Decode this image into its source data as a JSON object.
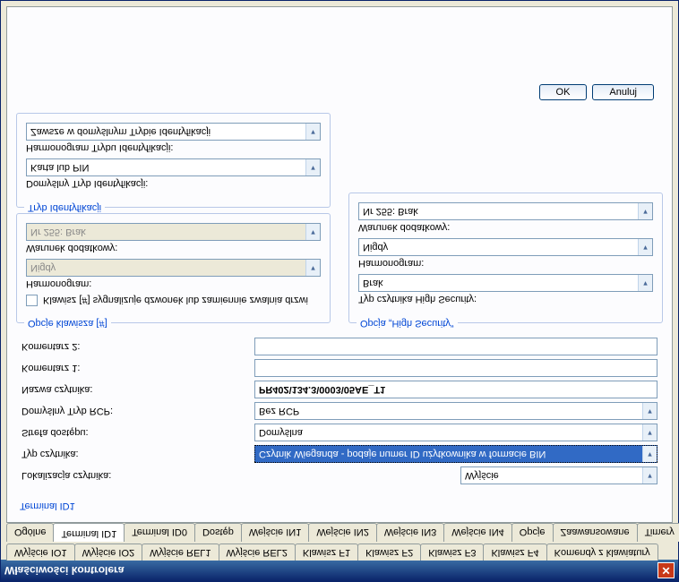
{
  "window_title": "Właściwości kontrolera",
  "buttons": {
    "ok": "OK",
    "cancel": "Anuluj"
  },
  "tabs_row1": [
    "Wyjście IO1",
    "Wyjście IO2",
    "Wyjście REL1",
    "Wyjście REL2",
    "Klawisz F1",
    "Klawisz F2",
    "Klawisz F3",
    "Klawisz F4",
    "Komendy z klawiatury"
  ],
  "tabs_row2": [
    "Ogólne",
    "Terminal ID1",
    "Terminal ID0",
    "Dostęp",
    "Wejście IN1",
    "Wejście IN2",
    "Wejście IN3",
    "Wejście IN4",
    "Opcje",
    "Zaawansowane",
    "Timery"
  ],
  "active_tab": "Terminal ID1",
  "terminal": {
    "section_title": "Terminal ID1",
    "lokalizacja_label": "Lokalizacja czytnika:",
    "lokalizacja_value": "Wyjście",
    "typ_label": "Typ czytnika:",
    "typ_value": "Czytnik Wieganda - podaje numer ID użytkownika w formacie BIN",
    "strefa_label": "Strefa dostępu:",
    "strefa_value": "Domyślna",
    "rcp_label": "Domyślny Tryb RCP:",
    "rcp_value": "Bez RCP",
    "nazwa_label": "Nazwa czytnika:",
    "nazwa_value": "PR402\\134.3\\0003\\05AE_T1",
    "kom1_label": "Komentarz 1:",
    "kom1_value": "",
    "kom2_label": "Komentarz 2:",
    "kom2_value": ""
  },
  "opcje_klawisza": {
    "legend": "Opcje klawisza [#]",
    "checkbox_label": "Klawisz [#] sygnalizuje dzwonek lub zamiennie zwalnia drzwi",
    "harmonogram_label": "Harmonogram:",
    "harmonogram_value": "Nigdy",
    "warunek_label": "Warunek dodatkowy:",
    "warunek_value": "Nr 255: Brak"
  },
  "high_security": {
    "legend": "Opcja „High Security”",
    "typ_label": "Typ czytnika High Security:",
    "typ_value": "Brak",
    "harmonogram_label": "Harmonogram:",
    "harmonogram_value": "Nigdy",
    "warunek_label": "Warunek dodatkowy:",
    "warunek_value": "Nr 255: Brak"
  },
  "tryb_ident": {
    "legend": "Tryb Identyfikacji",
    "domyslny_label": "Domyślny Tryb Identyfikacji:",
    "domyslny_value": "Karta lub PIN",
    "harmonogram_label": "Harmonogram Trybu Identyfikacji:",
    "harmonogram_value": "Zawsze w domyślnym Trybie Identyfikacji"
  }
}
